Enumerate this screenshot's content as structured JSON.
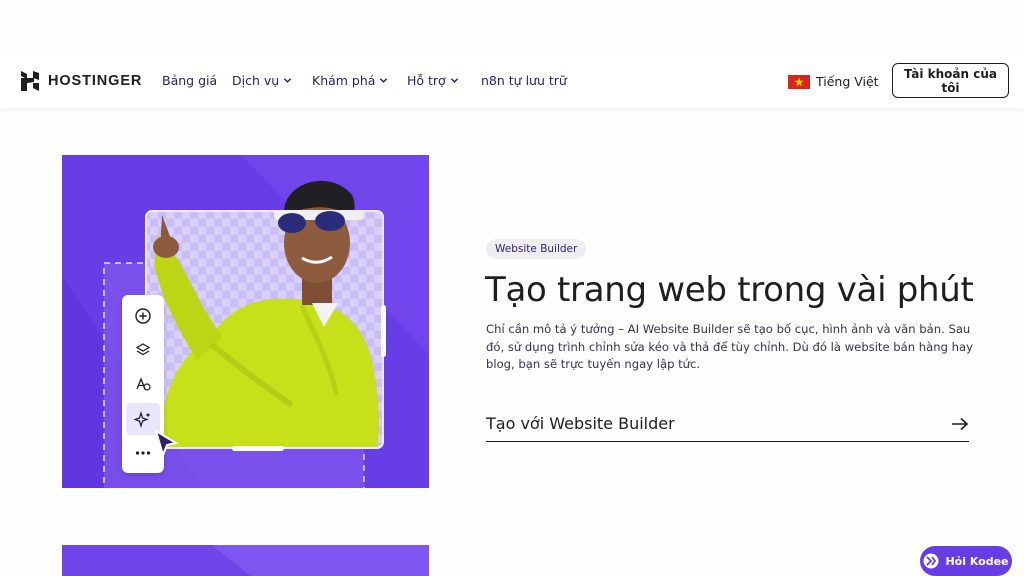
{
  "header": {
    "logo_text": "HOSTINGER",
    "nav": [
      {
        "label": "Bảng giá",
        "has_dropdown": false
      },
      {
        "label": "Dịch vụ",
        "has_dropdown": true
      },
      {
        "label": "Khám phá",
        "has_dropdown": true
      },
      {
        "label": "Hỗ trợ",
        "has_dropdown": true
      },
      {
        "label": "n8n tự lưu trữ",
        "has_dropdown": false
      }
    ],
    "language": "Tiếng Việt",
    "language_flag": "vietnam-flag-icon",
    "account_button": "Tài khoản của tôi"
  },
  "hero": {
    "badge": "Website Builder",
    "title": "Tạo trang web trong vài phút",
    "description": "Chỉ cần mô tả ý tưởng – AI Website Builder sẽ tạo bố cục, hình ảnh và văn bản. Sau đó, sử dụng trình chỉnh sửa kéo và thả để tùy chỉnh. Dù đó là website bán hàng hay blog, bạn sẽ trực tuyến ngay lập tức.",
    "cta_label": "Tạo với Website Builder",
    "editor_tools": [
      "plus-circle-icon",
      "layers-icon",
      "text-style-icon",
      "ai-sparkle-icon",
      "more-icon"
    ]
  },
  "chat": {
    "label": "Hỏi Kodee"
  },
  "colors": {
    "brand_purple": "#673de6",
    "accent_lime": "#c6e11a",
    "text_dark": "#1d1e20"
  }
}
